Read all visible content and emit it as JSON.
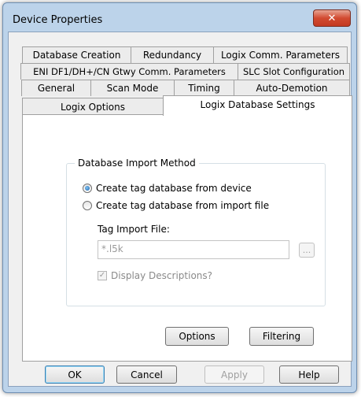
{
  "window": {
    "title": "Device Properties",
    "close_glyph": "✕"
  },
  "tabs": {
    "row1": [
      "Database Creation",
      "Redundancy",
      "Logix Comm. Parameters"
    ],
    "row2": [
      "ENI DF1/DH+/CN Gtwy Comm. Parameters",
      "SLC Slot Configuration"
    ],
    "row3": [
      "General",
      "Scan Mode",
      "Timing",
      "Auto-Demotion"
    ],
    "row4": [
      "Logix Options",
      "Logix Database Settings"
    ],
    "active": "Logix Database Settings"
  },
  "group": {
    "title": "Database Import Method",
    "radio_device": "Create tag database from device",
    "radio_file": "Create tag database from import file",
    "selected": "device",
    "tag_import_label": "Tag Import File:",
    "tag_import_value": "*.l5k",
    "browse_label": "...",
    "display_descriptions_label": "Display Descriptions?",
    "display_descriptions_checked": true,
    "check_glyph": "✓"
  },
  "panel_buttons": {
    "options": "Options",
    "filtering": "Filtering"
  },
  "dialog_buttons": {
    "ok": "OK",
    "cancel": "Cancel",
    "apply": "Apply",
    "help": "Help"
  },
  "icons": {
    "close": "close-icon",
    "radio_selected": "radio-selected-icon",
    "checkmark": "checkmark-icon"
  },
  "colors": {
    "frame": "#bcd3ea",
    "close_button": "#d24b31",
    "default_button_border": "#3c7fb1"
  }
}
